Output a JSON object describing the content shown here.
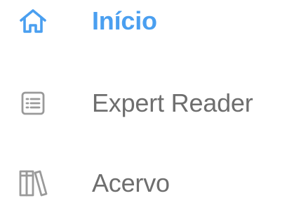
{
  "colors": {
    "accent": "#4a9ff0",
    "muted_text": "#6e6e6e",
    "icon_gray": "#9a9a9a"
  },
  "sidebar": {
    "items": [
      {
        "label": "Início",
        "icon": "home-icon",
        "active": true
      },
      {
        "label": "Expert Reader",
        "icon": "list-document-icon",
        "active": false
      },
      {
        "label": "Acervo",
        "icon": "library-books-icon",
        "active": false
      }
    ]
  }
}
